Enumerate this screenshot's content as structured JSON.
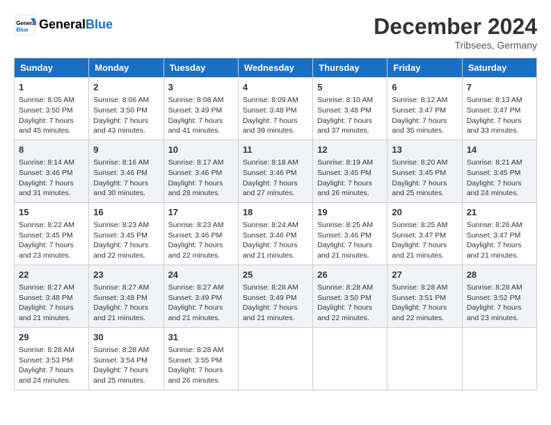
{
  "header": {
    "logo": "GeneralBlue",
    "month": "December 2024",
    "location": "Tribsees, Germany"
  },
  "days_of_week": [
    "Sunday",
    "Monday",
    "Tuesday",
    "Wednesday",
    "Thursday",
    "Friday",
    "Saturday"
  ],
  "weeks": [
    [
      {
        "day": "1",
        "sunrise": "8:05 AM",
        "sunset": "3:50 PM",
        "daylight": "7 hours and 45 minutes."
      },
      {
        "day": "2",
        "sunrise": "8:06 AM",
        "sunset": "3:50 PM",
        "daylight": "7 hours and 43 minutes."
      },
      {
        "day": "3",
        "sunrise": "8:08 AM",
        "sunset": "3:49 PM",
        "daylight": "7 hours and 41 minutes."
      },
      {
        "day": "4",
        "sunrise": "8:09 AM",
        "sunset": "3:48 PM",
        "daylight": "7 hours and 39 minutes."
      },
      {
        "day": "5",
        "sunrise": "8:10 AM",
        "sunset": "3:48 PM",
        "daylight": "7 hours and 37 minutes."
      },
      {
        "day": "6",
        "sunrise": "8:12 AM",
        "sunset": "3:47 PM",
        "daylight": "7 hours and 35 minutes."
      },
      {
        "day": "7",
        "sunrise": "8:13 AM",
        "sunset": "3:47 PM",
        "daylight": "7 hours and 33 minutes."
      }
    ],
    [
      {
        "day": "8",
        "sunrise": "8:14 AM",
        "sunset": "3:46 PM",
        "daylight": "7 hours and 31 minutes."
      },
      {
        "day": "9",
        "sunrise": "8:16 AM",
        "sunset": "3:46 PM",
        "daylight": "7 hours and 30 minutes."
      },
      {
        "day": "10",
        "sunrise": "8:17 AM",
        "sunset": "3:46 PM",
        "daylight": "7 hours and 28 minutes."
      },
      {
        "day": "11",
        "sunrise": "8:18 AM",
        "sunset": "3:46 PM",
        "daylight": "7 hours and 27 minutes."
      },
      {
        "day": "12",
        "sunrise": "8:19 AM",
        "sunset": "3:45 PM",
        "daylight": "7 hours and 26 minutes."
      },
      {
        "day": "13",
        "sunrise": "8:20 AM",
        "sunset": "3:45 PM",
        "daylight": "7 hours and 25 minutes."
      },
      {
        "day": "14",
        "sunrise": "8:21 AM",
        "sunset": "3:45 PM",
        "daylight": "7 hours and 24 minutes."
      }
    ],
    [
      {
        "day": "15",
        "sunrise": "8:22 AM",
        "sunset": "3:45 PM",
        "daylight": "7 hours and 23 minutes."
      },
      {
        "day": "16",
        "sunrise": "8:23 AM",
        "sunset": "3:45 PM",
        "daylight": "7 hours and 22 minutes."
      },
      {
        "day": "17",
        "sunrise": "8:23 AM",
        "sunset": "3:46 PM",
        "daylight": "7 hours and 22 minutes."
      },
      {
        "day": "18",
        "sunrise": "8:24 AM",
        "sunset": "3:46 PM",
        "daylight": "7 hours and 21 minutes."
      },
      {
        "day": "19",
        "sunrise": "8:25 AM",
        "sunset": "3:46 PM",
        "daylight": "7 hours and 21 minutes."
      },
      {
        "day": "20",
        "sunrise": "8:25 AM",
        "sunset": "3:47 PM",
        "daylight": "7 hours and 21 minutes."
      },
      {
        "day": "21",
        "sunrise": "8:26 AM",
        "sunset": "3:47 PM",
        "daylight": "7 hours and 21 minutes."
      }
    ],
    [
      {
        "day": "22",
        "sunrise": "8:27 AM",
        "sunset": "3:48 PM",
        "daylight": "7 hours and 21 minutes."
      },
      {
        "day": "23",
        "sunrise": "8:27 AM",
        "sunset": "3:48 PM",
        "daylight": "7 hours and 21 minutes."
      },
      {
        "day": "24",
        "sunrise": "8:27 AM",
        "sunset": "3:49 PM",
        "daylight": "7 hours and 21 minutes."
      },
      {
        "day": "25",
        "sunrise": "8:28 AM",
        "sunset": "3:49 PM",
        "daylight": "7 hours and 21 minutes."
      },
      {
        "day": "26",
        "sunrise": "8:28 AM",
        "sunset": "3:50 PM",
        "daylight": "7 hours and 22 minutes."
      },
      {
        "day": "27",
        "sunrise": "8:28 AM",
        "sunset": "3:51 PM",
        "daylight": "7 hours and 22 minutes."
      },
      {
        "day": "28",
        "sunrise": "8:28 AM",
        "sunset": "3:52 PM",
        "daylight": "7 hours and 23 minutes."
      }
    ],
    [
      {
        "day": "29",
        "sunrise": "8:28 AM",
        "sunset": "3:53 PM",
        "daylight": "7 hours and 24 minutes."
      },
      {
        "day": "30",
        "sunrise": "8:28 AM",
        "sunset": "3:54 PM",
        "daylight": "7 hours and 25 minutes."
      },
      {
        "day": "31",
        "sunrise": "8:28 AM",
        "sunset": "3:55 PM",
        "daylight": "7 hours and 26 minutes."
      },
      null,
      null,
      null,
      null
    ]
  ]
}
